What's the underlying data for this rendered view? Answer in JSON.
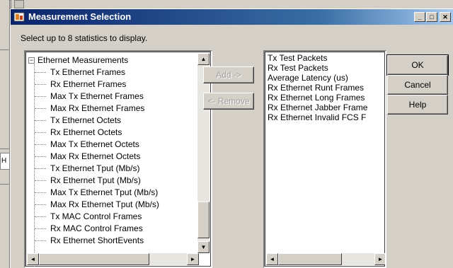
{
  "dialog": {
    "title": "Measurement Selection",
    "instruction": "Select up to 8 statistics to display.",
    "window_buttons": {
      "minimize_glyph": "_",
      "maximize_glyph": "□",
      "close_glyph": "✕"
    }
  },
  "background": {
    "tab_label": "H"
  },
  "tree": {
    "root_expander": "−",
    "root_label": "Ethernet Measurements",
    "items": [
      "Tx Ethernet Frames",
      "Rx Ethernet Frames",
      "Max Tx Ethernet Frames",
      "Max Rx Ethernet Frames",
      "Tx Ethernet Octets",
      "Rx Ethernet Octets",
      "Max Tx Ethernet Octets",
      "Max Rx Ethernet Octets",
      "Tx Ethernet Tput (Mb/s)",
      "Rx Ethernet Tput (Mb/s)",
      "Max Tx Ethernet Tput (Mb/s)",
      "Max Rx Ethernet Tput (Mb/s)",
      "Tx MAC Control Frames",
      "Rx MAC Control Frames",
      "Rx Ethernet ShortEvents"
    ]
  },
  "selected": {
    "items": [
      "Tx Test Packets",
      "Rx Test Packets",
      "Average Latency (us)",
      "Rx Ethernet Runt Frames",
      "Rx Ethernet Long Frames",
      "Rx Ethernet Jabber Frame",
      "Rx Ethernet Invalid FCS F"
    ]
  },
  "buttons": {
    "add": "Add ->",
    "remove": "<- Remove",
    "ok": "OK",
    "cancel": "Cancel",
    "help": "Help"
  },
  "scroll": {
    "up_glyph": "▲",
    "down_glyph": "▼",
    "left_glyph": "◄",
    "right_glyph": "►"
  },
  "colors": {
    "title_start": "#0a246a",
    "title_end": "#a6caf0",
    "face": "#d4d0c8"
  }
}
